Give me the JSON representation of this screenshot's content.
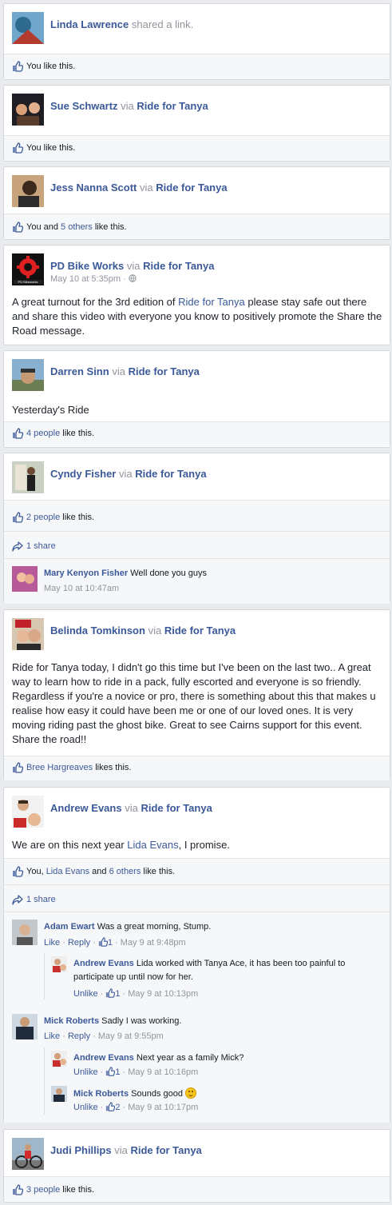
{
  "posts": [
    {
      "author": "Linda Lawrence",
      "action": "shared a link.",
      "likes": "You like this."
    },
    {
      "author": "Sue Schwartz",
      "via": "via",
      "page": "Ride for Tanya",
      "likes": "You like this."
    },
    {
      "author": "Jess Nanna Scott",
      "via": "via",
      "page": "Ride for Tanya",
      "likes_prefix": "You and ",
      "likes_link": "5 others",
      "likes_suffix": " like this."
    },
    {
      "author": "PD Bike Works",
      "via": "via",
      "page": "Ride for Tanya",
      "timestamp": "May 10 at 5:35pm",
      "logo_text": "PD Bikeworks",
      "text_before": "A great turnout for the 3rd edition of ",
      "text_link": "Ride for Tanya",
      "text_after": " please stay safe out there and share this video with everyone you know to positively promote the Share the Road message."
    },
    {
      "author": "Darren Sinn",
      "via": "via",
      "page": "Ride for Tanya",
      "text": "Yesterday's Ride",
      "likes_link": "4 people",
      "likes_suffix": " like this."
    },
    {
      "author": "Cyndy Fisher",
      "via": "via",
      "page": "Ride for Tanya",
      "likes_link": "2 people",
      "likes_suffix": " like this.",
      "shares": "1 share",
      "comment": {
        "author": "Mary Kenyon Fisher",
        "text": "Well done you guys",
        "time": "May 10 at 10:47am"
      }
    },
    {
      "author": "Belinda Tomkinson",
      "via": "via",
      "page": "Ride for Tanya",
      "text": "Ride for Tanya today, I didn't go this time but I've been on the last two.. A great way to learn how to ride in a pack, fully escorted and everyone is so friendly. Regardless if you're a novice or pro, there is something about this that makes u realise how easy it could have been me or one of our loved ones. It is very moving riding past the ghost bike. Great to see Cairns support for this event. Share the road!!",
      "likes_link": "Bree Hargreaves",
      "likes_suffix": " likes this."
    },
    {
      "author": "Andrew Evans",
      "via": "via",
      "page": "Ride for Tanya",
      "text_before": "We are on this next year ",
      "text_link": "Lida Evans",
      "text_after": ", I promise.",
      "likes_prefix": "You, ",
      "likes_link1": "Lida Evans",
      "likes_mid": " and ",
      "likes_link2": "6 others",
      "likes_suffix": " like this.",
      "shares": "1 share",
      "comments": [
        {
          "author": "Adam Ewart",
          "text": "Was a great morning, Stump.",
          "like": "Like",
          "reply": "Reply",
          "count": "1",
          "time": "May 9 at 9:48pm",
          "reply_comment": {
            "author": "Andrew Evans",
            "text": "Lida worked with Tanya Ace, it has been too painful to",
            "text2": "participate up until now for her.",
            "unlike": "Unlike",
            "count": "1",
            "time": "May 9 at 10:13pm"
          }
        },
        {
          "author": "Mick Roberts",
          "text": "Sadly I was working.",
          "like": "Like",
          "reply": "Reply",
          "time": "May 9 at 9:55pm",
          "replies": [
            {
              "author": "Andrew Evans",
              "text": "Next year as a family Mick?",
              "unlike": "Unlike",
              "count": "1",
              "time": "May 9 at 10:16pm"
            },
            {
              "author": "Mick Roberts",
              "text": "Sounds good",
              "unlike": "Unlike",
              "count": "2",
              "time": "May 9 at 10:17pm"
            }
          ]
        }
      ]
    },
    {
      "author": "Judi Phillips",
      "via": "via",
      "page": "Ride for Tanya",
      "likes_link": "3 people",
      "likes_suffix": " like this."
    }
  ],
  "colors": {
    "link": "#3b5998",
    "muted": "#90949c",
    "bar": "#f6f7f9",
    "border": "#d3d6db"
  }
}
